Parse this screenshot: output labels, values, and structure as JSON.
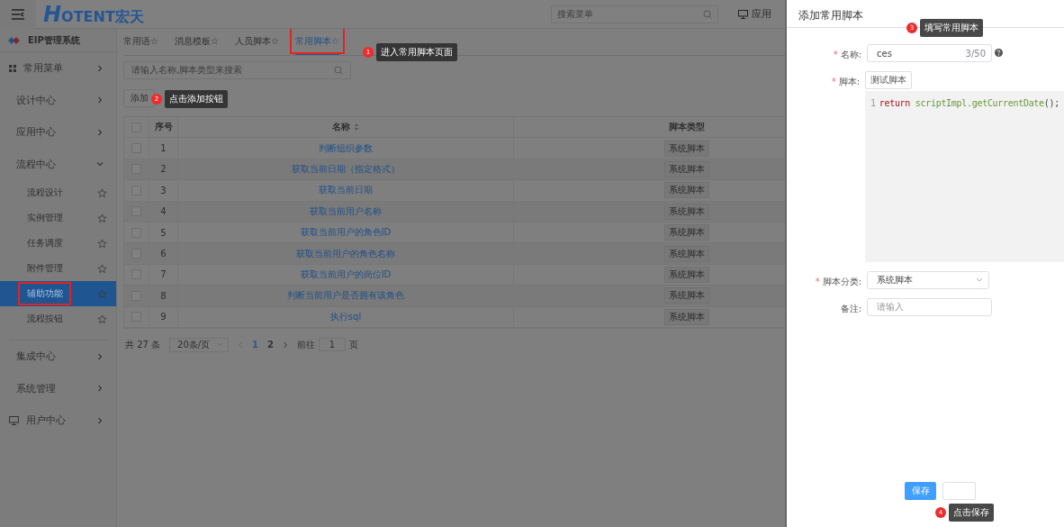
{
  "header": {
    "logo_mark": "H",
    "logo_text": "OTENT宏天",
    "menu_search": {
      "placeholder": "搜索菜单"
    },
    "app_link": "应用"
  },
  "sidebar": {
    "system": "EIP管理系统",
    "items": [
      {
        "kind": "grid",
        "label": "常用菜单",
        "expanded": false
      },
      {
        "kind": "plain",
        "label": "设计中心",
        "expanded": false
      },
      {
        "kind": "plain",
        "label": "应用中心",
        "expanded": false
      },
      {
        "kind": "plain",
        "label": "流程中心",
        "expanded": true,
        "children": [
          {
            "label": "流程设计",
            "selected": false,
            "annotated": false
          },
          {
            "label": "实例管理",
            "selected": false,
            "annotated": false
          },
          {
            "label": "任务调度",
            "selected": false,
            "annotated": false
          },
          {
            "label": "附件管理",
            "selected": false,
            "annotated": false
          },
          {
            "label": "辅助功能",
            "selected": true,
            "annotated": true
          },
          {
            "label": "流程按钮",
            "selected": false,
            "annotated": false
          }
        ]
      },
      {
        "kind": "plain",
        "label": "集成中心",
        "expanded": false
      },
      {
        "kind": "plain",
        "label": "系统管理",
        "expanded": false
      },
      {
        "kind": "monitor",
        "label": "用户中心",
        "expanded": false
      }
    ]
  },
  "tabs": [
    {
      "label": "常用语☆",
      "selected": false,
      "annotated": false
    },
    {
      "label": "消息模板☆",
      "selected": false,
      "annotated": false
    },
    {
      "label": "人员脚本☆",
      "selected": false,
      "annotated": false
    },
    {
      "label": "常用脚本☆",
      "selected": true,
      "annotated": true
    }
  ],
  "search": {
    "placeholder": "请输入名称,脚本类型来搜索"
  },
  "add_button": "添加",
  "table": {
    "select_all_checked": false,
    "columns": [
      "序号",
      "名称",
      "脚本类型"
    ],
    "rows": [
      {
        "checked": false,
        "index": "1",
        "name": "判断组织参数",
        "type": "系统脚本"
      },
      {
        "checked": false,
        "index": "2",
        "name": "获取当前日期（指定格式）",
        "type": "系统脚本"
      },
      {
        "checked": false,
        "index": "3",
        "name": "获取当前日期",
        "type": "系统脚本"
      },
      {
        "checked": false,
        "index": "4",
        "name": "获取当前用户名称",
        "type": "系统脚本"
      },
      {
        "checked": false,
        "index": "5",
        "name": "获取当前用户的角色ID",
        "type": "系统脚本"
      },
      {
        "checked": false,
        "index": "6",
        "name": "获取当前用户的角色名称",
        "type": "系统脚本"
      },
      {
        "checked": false,
        "index": "7",
        "name": "获取当前用户的岗位ID",
        "type": "系统脚本"
      },
      {
        "checked": false,
        "index": "8",
        "name": "判断当前用户是否拥有该角色",
        "type": "系统脚本"
      },
      {
        "checked": false,
        "index": "9",
        "name": "执行sql",
        "type": "系统脚本"
      }
    ]
  },
  "pagination": {
    "total": "共 27 条",
    "page_size": "20条/页",
    "pages": [
      {
        "label": "1",
        "selected": true
      },
      {
        "label": "2",
        "selected": false
      }
    ],
    "goto_label": "前往",
    "goto_value": "1",
    "goto_suffix": "页"
  },
  "drawer": {
    "title": "添加常用脚本",
    "fields": [
      {
        "kind": "text",
        "required_mark": "*",
        "label": "名称:",
        "value": "ces",
        "count": "3/50"
      },
      {
        "kind": "script",
        "required_mark": "*",
        "label": "脚本:",
        "button": "测试脚本",
        "line_number": "1",
        "code": [
          {
            "kind": "keyword",
            "text": "return"
          },
          {
            "kind": "call",
            "text": "scriptImpl.getCurrentDate"
          },
          {
            "kind": "plain",
            "text": "();"
          }
        ]
      },
      {
        "kind": "select",
        "required_mark": "*",
        "label": "脚本分类:",
        "value": "系统脚本"
      },
      {
        "kind": "text",
        "label": "备注:",
        "placeholder": "请输入"
      }
    ],
    "save_button": "保存"
  },
  "callouts": [
    {
      "number": "1",
      "text": "进入常用脚本页面"
    },
    {
      "number": "2",
      "text": "点击添加按钮"
    },
    {
      "number": "3",
      "text": "填写常用脚本"
    },
    {
      "number": "4",
      "text": "点击保存"
    }
  ]
}
